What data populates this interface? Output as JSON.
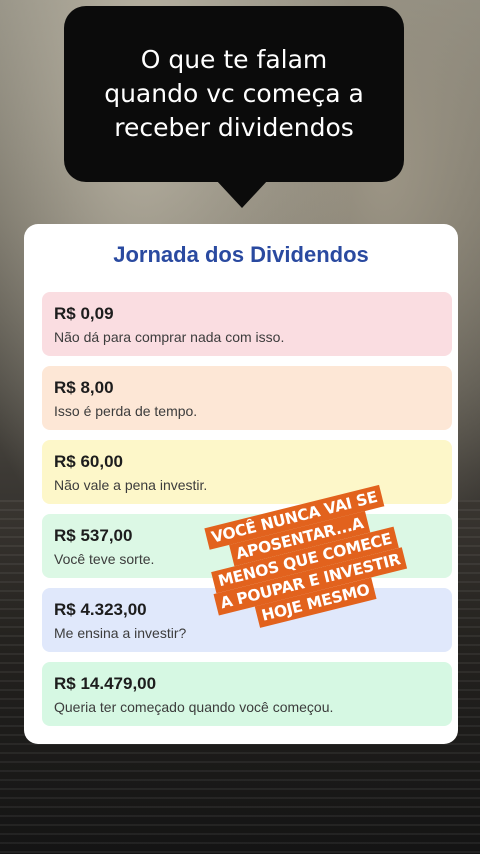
{
  "caption": "O que te falam\nquando vc começa a\nreceber dividendos",
  "card": {
    "title": "Jornada dos Dividendos",
    "items": [
      {
        "amount": "R$ 0,09",
        "message": "Não dá para comprar nada com isso.",
        "color": "#fadde1"
      },
      {
        "amount": "R$ 8,00",
        "message": "Isso é perda de tempo.",
        "color": "#fde7d6"
      },
      {
        "amount": "R$ 60,00",
        "message": "Não vale a pena investir.",
        "color": "#fdf7c9"
      },
      {
        "amount": "R$ 537,00",
        "message": "Você teve sorte.",
        "color": "#dcf8e5"
      },
      {
        "amount": "R$ 4.323,00",
        "message": "Me ensina a investir?",
        "color": "#e0e8fb"
      },
      {
        "amount": "R$ 14.479,00",
        "message": "Queria ter começado quando você começou.",
        "color": "#d6f8e3"
      }
    ]
  },
  "sticker": {
    "text": "VOCÊ NUNCA VAI SE APOSENTAR...A MENOS QUE COMECE A POUPAR E INVESTIR HOJE MESMO",
    "color": "#e2621d"
  }
}
